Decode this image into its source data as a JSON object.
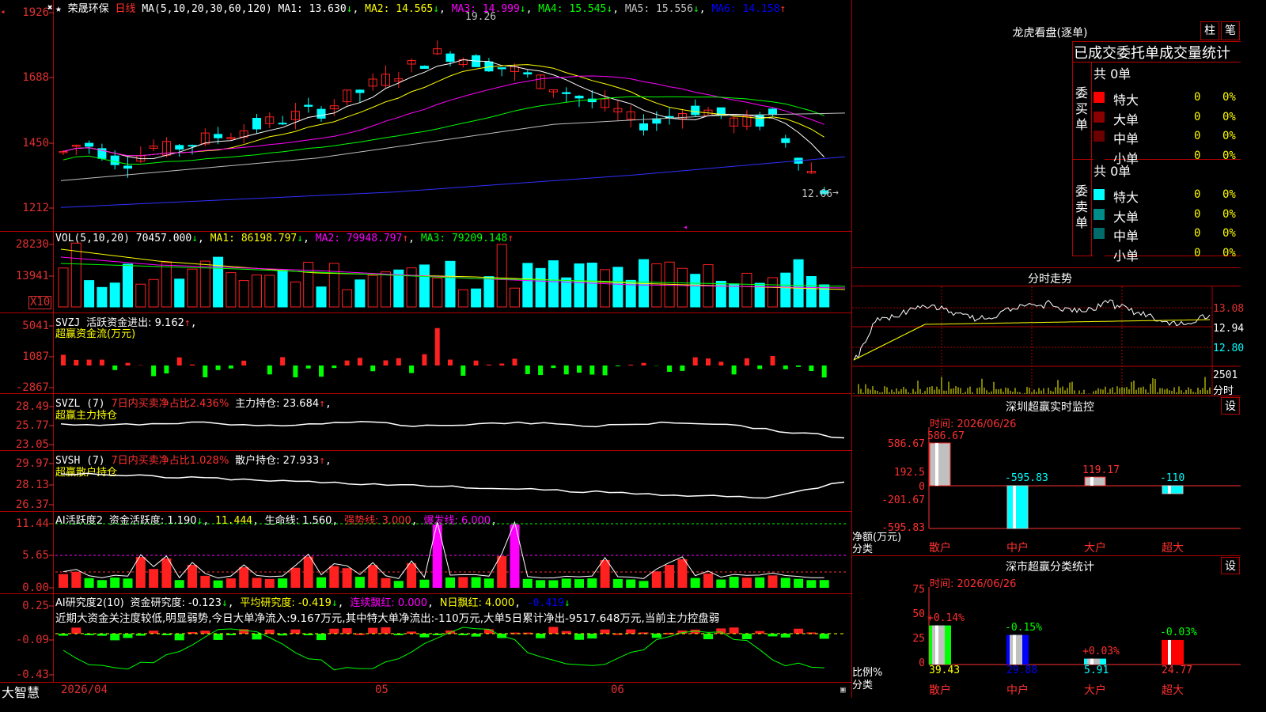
{
  "stock": {
    "name": "荣晟环保",
    "period": "日线",
    "stars": "★"
  },
  "main_chart": {
    "ma_header": "MA(5,10,20,30,60,120)",
    "ma": [
      {
        "label": "MA1: 13.630",
        "arrow": "↓",
        "color": "#ffffff"
      },
      {
        "label": "MA2: 14.565",
        "arrow": "↓",
        "color": "#ffff00"
      },
      {
        "label": "MA3: 14.999",
        "arrow": "↓",
        "color": "#ff00ff"
      },
      {
        "label": "MA4: 15.545",
        "arrow": "↓",
        "color": "#00ff00"
      },
      {
        "label": "MA5: 15.556",
        "arrow": "↓",
        "color": "#c0c0c0"
      },
      {
        "label": "MA6: 14.158",
        "arrow": "↑",
        "color": "#0000ff"
      }
    ],
    "y_ticks": [
      "1926",
      "1688",
      "1450",
      "1212"
    ],
    "high_label": "19.26",
    "low_label": "12.66"
  },
  "vol_panel": {
    "header": "VOL(5,10,20)",
    "vol": "70457.000",
    "vol_arrow": "↓",
    "ma1": "MA1: 86198.797",
    "ma1_arrow": "↓",
    "ma2": "MA2: 79948.797",
    "ma2_arrow": "↑",
    "ma3": "MA3: 79209.148",
    "ma3_arrow": "↑",
    "y_ticks": [
      "28230",
      "13941"
    ],
    "unit": "X10"
  },
  "svzj_panel": {
    "name": "SVZJ",
    "label": "活跃资金进出: 9.162",
    "arrow": "↑",
    "sub": "超赢资金流(万元)",
    "y_ticks": [
      "5041",
      "1087",
      "-2867"
    ]
  },
  "svzl_panel": {
    "name": "SVZL  (7)",
    "pct": "7日内买卖净占比2.436%",
    "label": "主力持仓: 23.684",
    "arrow": "↑",
    "sub": "超赢主力持仓",
    "y_ticks": [
      "28.49",
      "25.77",
      "23.05"
    ]
  },
  "svsh_panel": {
    "name": "SVSH  (7)",
    "pct": "7日内买卖净占比1.028%",
    "label": "散户持仓: 27.933",
    "arrow": "↑",
    "sub": "超赢散户持仓",
    "y_ticks": [
      "29.97",
      "28.13",
      "26.37"
    ]
  },
  "ai_active_panel": {
    "name": "AI活跃度2",
    "label": "资金活跃度: 1.190",
    "arrow": "↓",
    "v2": "11.444",
    "life": "生命线: 1.560",
    "strong": "强势线: 3.000",
    "burst": "爆发线: 6.000",
    "y_ticks": [
      "11.44",
      "5.65",
      "0.00"
    ]
  },
  "ai_research_panel": {
    "name": "AI研究度2(10)",
    "label": "资金研究度: -0.123",
    "arrow": "↓",
    "avg": "平均研究度: -0.419",
    "avg_arrow": "↓",
    "cont": "连续飘红: 0.000",
    "n": "N日飘红: 4.000",
    "last": "-0.419",
    "last_arrow": "↓",
    "comment": "近期大资金关注度较低,明显弱势,今日大单净流入:9.167万元,其中特大单净流出:-110万元,大单5日累计净出-9517.648万元,当前主力控盘弱",
    "y_ticks": [
      "0.25",
      "-0.09",
      "-0.43"
    ]
  },
  "x_axis": {
    "brand": "大智慧",
    "dates": [
      "2026/04",
      "05",
      "06"
    ]
  },
  "dragon": {
    "title": "龙虎看盘(逐单)",
    "btn1": "柱",
    "btn2": "笔",
    "tabs": "已成交委托单成交量统计",
    "buy_side": "委买单",
    "sell_side": "委卖单",
    "buy_total": "共 0单",
    "sell_total": "共 0单",
    "rows": [
      {
        "name": "特大",
        "count": "0",
        "pct": "0%"
      },
      {
        "name": "大单",
        "count": "0",
        "pct": "0%"
      },
      {
        "name": "中单",
        "count": "0",
        "pct": "0%"
      },
      {
        "name": "小单",
        "count": "0",
        "pct": "0%"
      }
    ],
    "buy_colors": [
      "#ff0000",
      "#8b0000",
      "#6b0000",
      "#000000"
    ],
    "sell_colors": [
      "#00ffff",
      "#008b8b",
      "#006b6b",
      "#000000"
    ]
  },
  "intraday": {
    "title": "分时走势",
    "p1": "13.08",
    "p2": "12.94",
    "p3": "12.80",
    "vol": "2501",
    "vol_label": "分时"
  },
  "monitor": {
    "title": "深圳超赢实时监控",
    "btn": "设",
    "time": "时间: 2026/06/26",
    "y_ticks": [
      "586.67",
      "192.5",
      "0",
      "-201.67",
      "-595.83"
    ],
    "unit": "净额(万元)",
    "unit2": "分类",
    "bars": [
      {
        "cat": "散户",
        "value": 586.67,
        "label": "586.67"
      },
      {
        "cat": "中户",
        "value": -595.83,
        "label": "-595.83"
      },
      {
        "cat": "大户",
        "value": 119.17,
        "label": "119.17"
      },
      {
        "cat": "超大",
        "value": -110,
        "label": "-110"
      }
    ]
  },
  "classify": {
    "title": "深市超赢分类统计",
    "btn": "设",
    "time": "时间: 2026/06/26",
    "y_ticks": [
      "75",
      "50",
      "25",
      "0"
    ],
    "unit": "比例%",
    "unit2": "分类",
    "bars": [
      {
        "cat": "散户",
        "value": 39.43,
        "label": "39.43",
        "delta": "+0.14%",
        "color": "#00ff00"
      },
      {
        "cat": "中户",
        "value": 29.88,
        "label": "29.88",
        "delta": "-0.15%",
        "color": "#0000ff"
      },
      {
        "cat": "大户",
        "value": 5.91,
        "label": "5.91",
        "delta": "+0.03%",
        "color": "#00ffff"
      },
      {
        "cat": "超大",
        "value": 24.77,
        "label": "24.77",
        "delta": "-0.03%",
        "color": "#ff0000"
      }
    ]
  }
}
